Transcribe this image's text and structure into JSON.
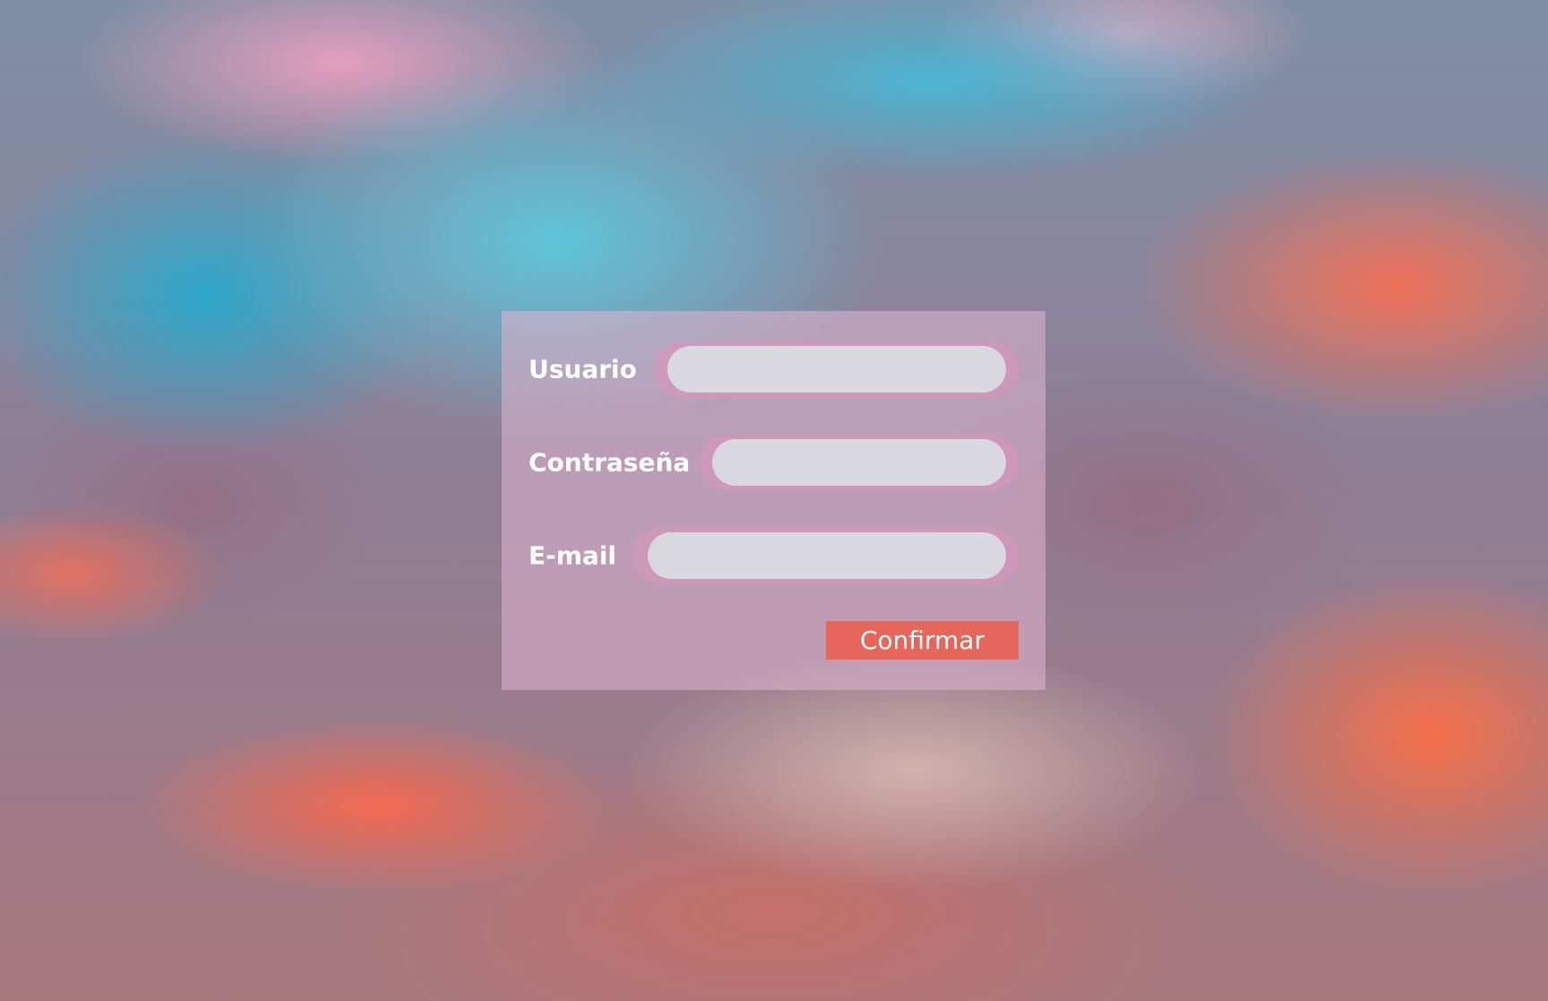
{
  "form": {
    "fields": [
      {
        "label": "Usuario",
        "value": "",
        "placeholder": ""
      },
      {
        "label": "Contraseña",
        "value": "",
        "placeholder": ""
      },
      {
        "label": "E-mail",
        "value": "",
        "placeholder": ""
      }
    ],
    "submit_label": "Confirmar"
  },
  "colors": {
    "button": "#e6665b",
    "input_fill": "#d9d8e0",
    "input_ring": "#d496ba"
  }
}
